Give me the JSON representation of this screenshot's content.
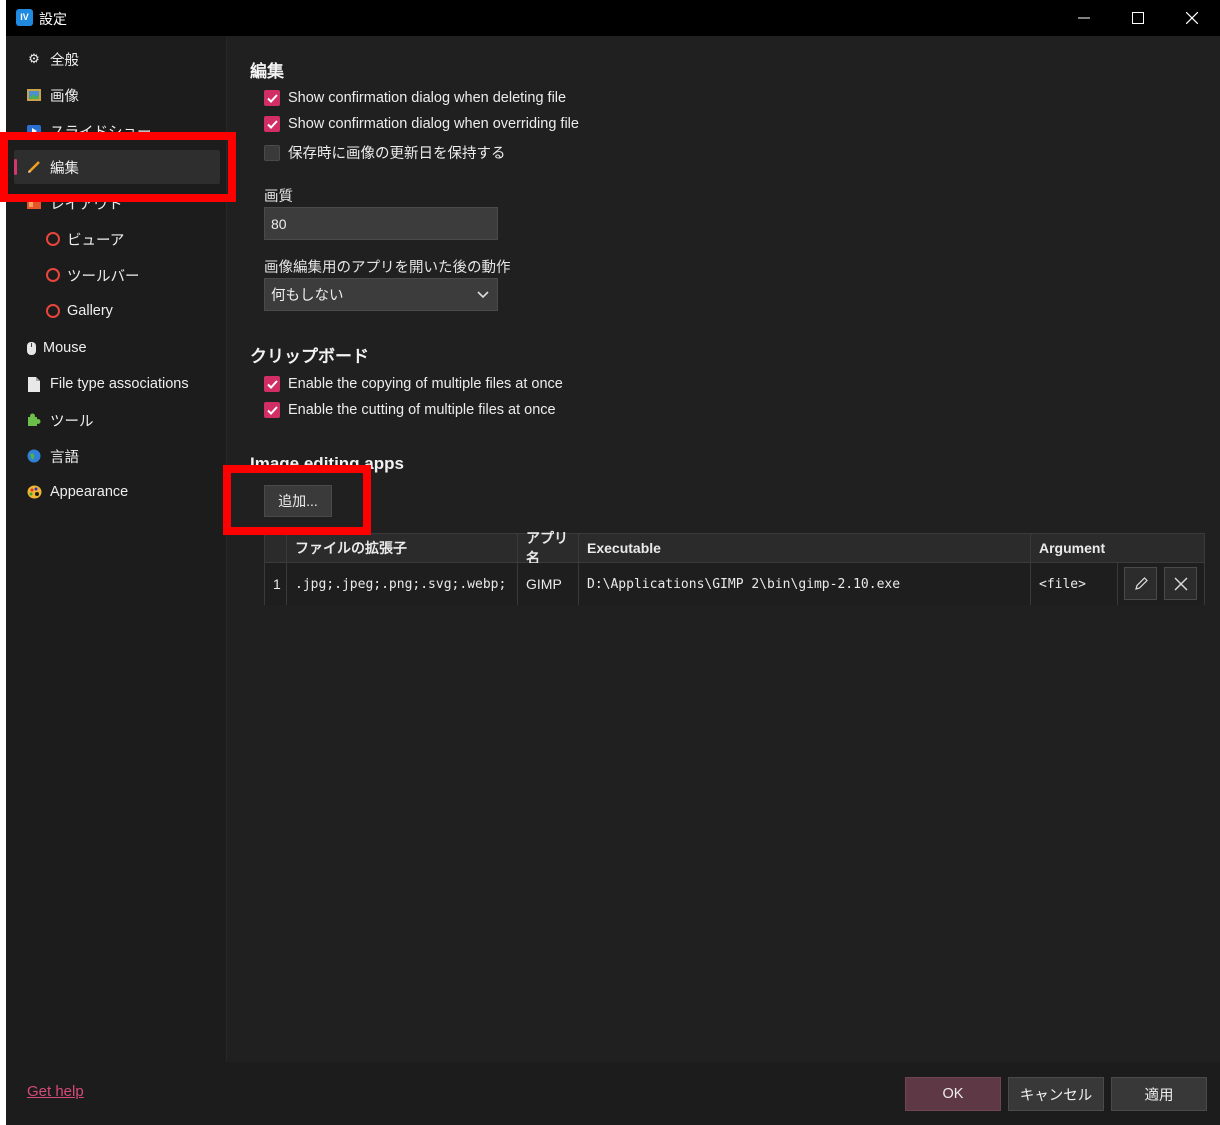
{
  "window": {
    "title": "設定",
    "app_icon_label": "IV"
  },
  "sidebar": {
    "items": [
      {
        "label": "全般",
        "icon": "gear-icon"
      },
      {
        "label": "画像",
        "icon": "image-icon"
      },
      {
        "label": "スライドショー",
        "icon": "slideshow-icon"
      },
      {
        "label": "編集",
        "icon": "pencil-icon",
        "selected": true
      },
      {
        "label": "レイアウト",
        "icon": "layout-icon"
      },
      {
        "label": "ビューア",
        "icon": "ring-icon"
      },
      {
        "label": "ツールバー",
        "icon": "ring-icon"
      },
      {
        "label": "Gallery",
        "icon": "ring-icon"
      },
      {
        "label": "Mouse",
        "icon": "mouse-icon"
      },
      {
        "label": "File type associations",
        "icon": "file-icon"
      },
      {
        "label": "ツール",
        "icon": "puzzle-icon"
      },
      {
        "label": "言語",
        "icon": "globe-icon"
      },
      {
        "label": "Appearance",
        "icon": "palette-icon"
      }
    ],
    "get_help": "Get help"
  },
  "edit": {
    "title": "編集",
    "options": [
      {
        "label": "Show confirmation dialog when deleting file",
        "checked": true
      },
      {
        "label": "Show confirmation dialog when overriding file",
        "checked": true
      },
      {
        "label": "保存時に画像の更新日を保持する",
        "checked": false
      }
    ],
    "quality_label": "画質",
    "quality_value": "80",
    "after_open_label": "画像編集用のアプリを開いた後の動作",
    "after_open_value": "何もしない"
  },
  "clipboard": {
    "title": "クリップボード",
    "options": [
      {
        "label": "Enable the copying of multiple files at once",
        "checked": true
      },
      {
        "label": "Enable the cutting of multiple files at once",
        "checked": true
      }
    ]
  },
  "apps": {
    "title": "Image editing apps",
    "add_label": "追加...",
    "columns": [
      "ファイルの拡張子",
      "アプリ名",
      "Executable",
      "Argument"
    ],
    "rows": [
      {
        "index": "1",
        "ext": ".jpg;.jpeg;.png;.svg;.webp;",
        "name": "GIMP",
        "exe": "D:\\Applications\\GIMP 2\\bin\\gimp-2.10.exe",
        "arg": "<file>"
      }
    ]
  },
  "footer": {
    "ok": "OK",
    "cancel": "キャンセル",
    "apply": "適用"
  },
  "colors": {
    "accent": "#d12e66",
    "highlight": "#ff0000",
    "background": "#1c1c1c"
  }
}
